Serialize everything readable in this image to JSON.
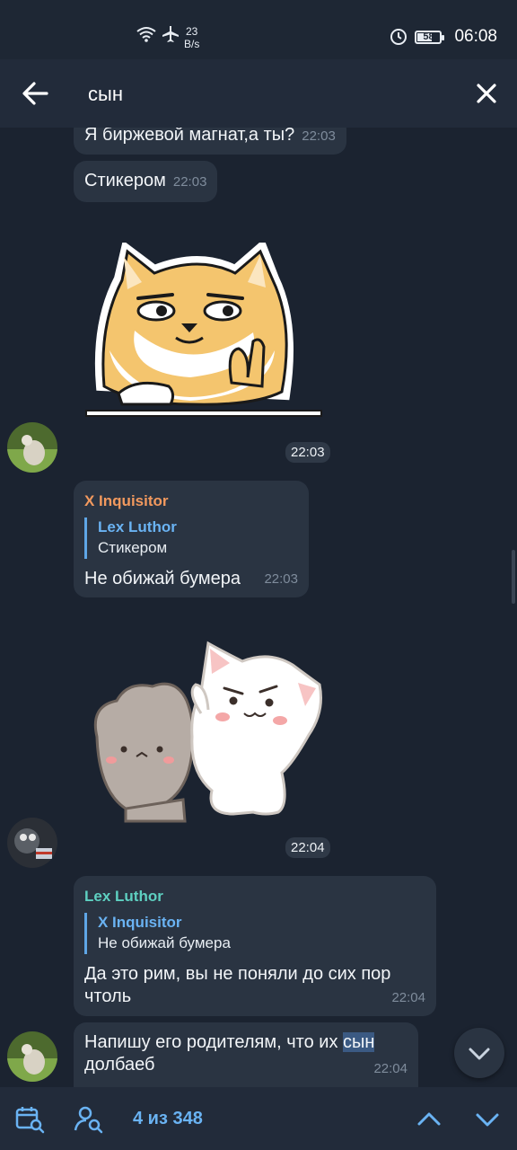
{
  "status_bar": {
    "network_speed_value": "23",
    "network_speed_unit": "B/s",
    "battery": "58",
    "time": "06:08",
    "icons": [
      "wifi-icon",
      "airplane-mode-icon",
      "data-saver-icon",
      "battery-icon"
    ]
  },
  "search_bar": {
    "query": "сын",
    "back_icon": "arrow-left-icon",
    "close_icon": "close-icon"
  },
  "messages": [
    {
      "text": "Я биржевой магнат,а ты?",
      "time": "22:03"
    },
    {
      "text": "Стикером",
      "time": "22:03"
    },
    {
      "type": "sticker",
      "description_icon": "shiba-dog-sticker",
      "time": "22:03"
    },
    {
      "sender": "X Inquisitor",
      "reply_to": {
        "name": "Lex Luthor",
        "text": "Стикером"
      },
      "text": "Не обижай бумера",
      "time": "22:03"
    },
    {
      "type": "sticker",
      "description_icon": "cats-sticker",
      "time": "22:04"
    },
    {
      "sender": "Lex Luthor",
      "reply_to": {
        "name": "X Inquisitor",
        "text": "Не обижай бумера"
      },
      "text": "Да это рим, вы не поняли до сих пор чтоль",
      "time": "22:04"
    },
    {
      "text_before": "Напишу его родителям, что их ",
      "highlight": "сын",
      "text_after": "долбаеб",
      "time": "22:04"
    }
  ],
  "bottom_bar": {
    "counter": "4 из 348",
    "icons": [
      "calendar-search-icon",
      "user-search-icon",
      "chevron-up-icon",
      "chevron-down-icon"
    ]
  },
  "colors": {
    "background": "#1b2330",
    "bubble": "#2a3442",
    "accent": "#6ab3f3",
    "sender_orange": "#f2995e",
    "sender_teal": "#5ed0c1"
  }
}
